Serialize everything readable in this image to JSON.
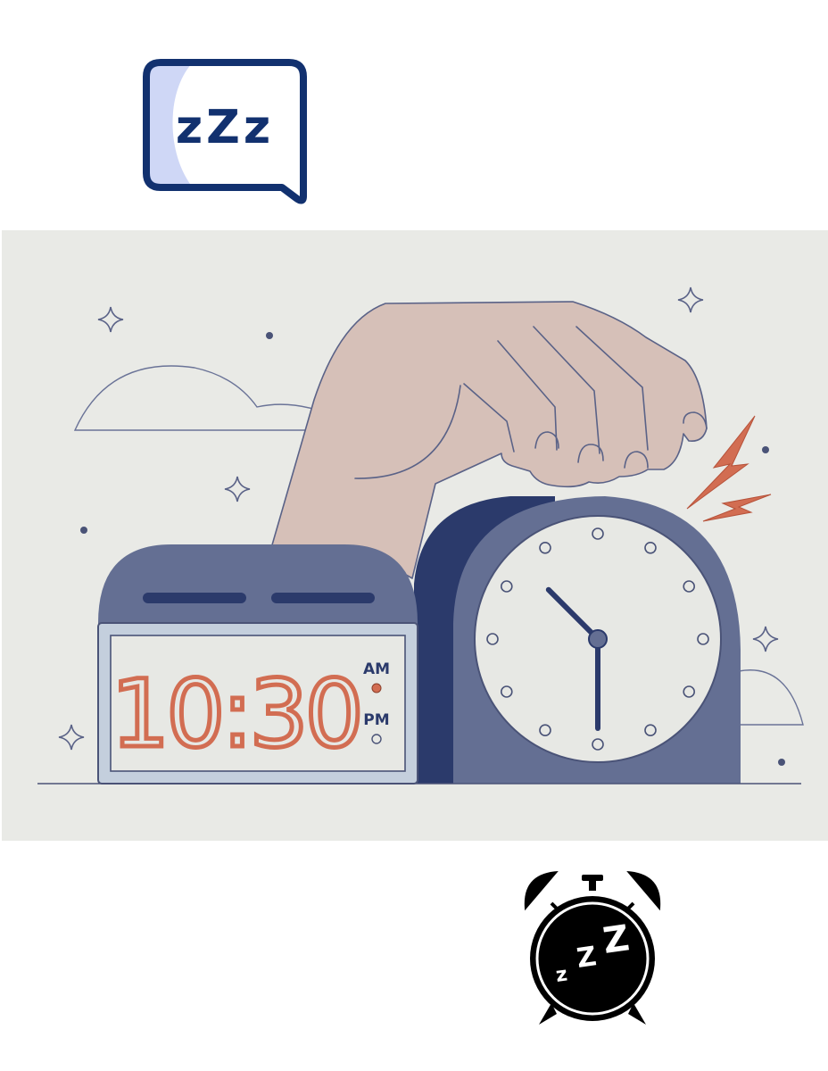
{
  "sleep_icon": {
    "text": "zZz"
  },
  "illustration": {
    "digital_clock": {
      "time": "10:30",
      "am_label": "AM",
      "pm_label": "PM",
      "active_period": "AM"
    },
    "analog_clock": {
      "hour": 10,
      "minute": 30
    },
    "colors": {
      "background": "#e9eae6",
      "navy": "#2b3a6b",
      "slate": "#646f93",
      "digit_orange": "#d26d52",
      "skin": "#d6c0b8",
      "screen": "#e7e8e4"
    }
  },
  "alarm_icon": {
    "text": "zZZ"
  }
}
